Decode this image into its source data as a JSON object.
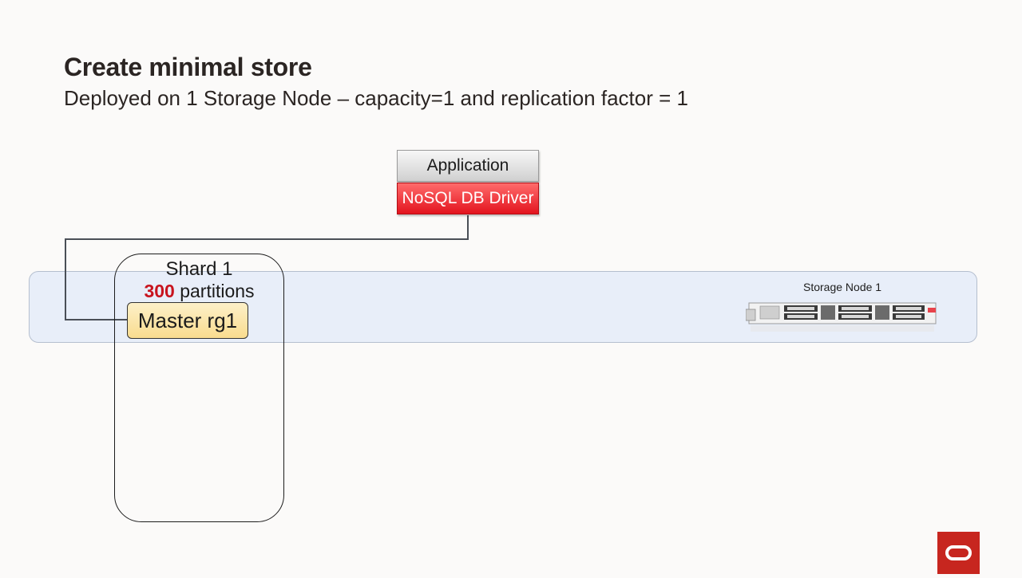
{
  "slide": {
    "title": "Create minimal store",
    "subtitle": "Deployed on 1 Storage Node – capacity=1 and replication factor = 1"
  },
  "application": {
    "label": "Application",
    "driver_label": "NoSQL DB Driver"
  },
  "storage_node": {
    "label": "Storage Node 1"
  },
  "shard": {
    "title": "Shard  1",
    "partition_count": "300",
    "partition_label": " partitions",
    "master_label": "Master rg1"
  },
  "colors": {
    "background": "#fbfaf9",
    "band_fill": "#e8eef9",
    "driver_red": "#e3141f",
    "partition_count_red": "#c8141e",
    "master_fill": "#f9dc8f",
    "logo_red": "#c7261f"
  },
  "icons": {
    "server": "rack-server-icon",
    "logo": "oracle-logo-icon"
  }
}
